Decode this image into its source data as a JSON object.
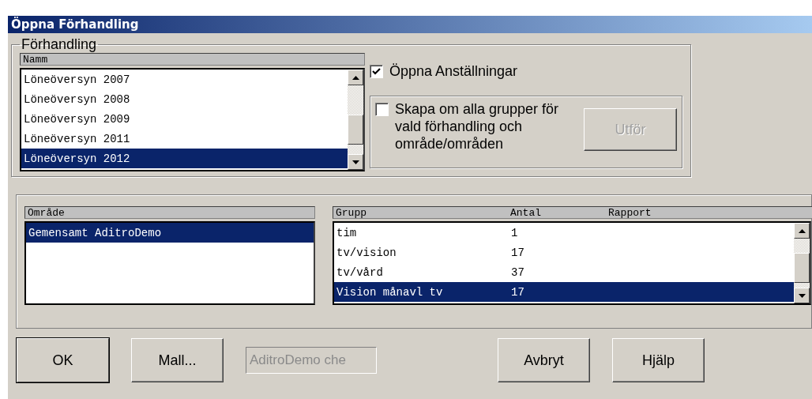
{
  "window": {
    "title": "Öppna Förhandling"
  },
  "negotiation": {
    "legend": "Förhandling",
    "column": "Namm",
    "rows": [
      {
        "name": "Löneöversyn 2007",
        "selected": false
      },
      {
        "name": "Löneöversyn 2008",
        "selected": false
      },
      {
        "name": "Löneöversyn 2009",
        "selected": false
      },
      {
        "name": "Löneöversyn 2011",
        "selected": false
      },
      {
        "name": "Löneöversyn 2012",
        "selected": true
      }
    ]
  },
  "open_employments": {
    "label": "Öppna Anställningar",
    "checked": true
  },
  "rebuild": {
    "label": "Skapa om alla grupper för vald förhandling och område/områden",
    "checked": false,
    "button": {
      "label": "Utför",
      "disabled": true
    }
  },
  "areas": {
    "column": "Område",
    "rows": [
      {
        "name": "Gemensamt AditroDemo",
        "selected": true
      }
    ]
  },
  "groups": {
    "columns": [
      "Grupp",
      "Antal",
      "Rapport"
    ],
    "rows": [
      {
        "cells": [
          "tim",
          "1"
        ],
        "selected": false
      },
      {
        "cells": [
          "tv/vision",
          "17"
        ],
        "selected": false
      },
      {
        "cells": [
          "tv/vård",
          "37"
        ],
        "selected": false
      },
      {
        "cells": [
          "Vision månavl tv",
          "17"
        ],
        "selected": true
      }
    ]
  },
  "buttons": [
    {
      "label": "OK",
      "kind": "default"
    },
    {
      "label": "Mall...",
      "kind": "normal"
    },
    {
      "value": "AditroDemo che",
      "kind": "field",
      "disabled": true
    },
    {
      "label": "Avbryt",
      "kind": "normal"
    },
    {
      "label": "Hjälp",
      "kind": "normal"
    }
  ]
}
